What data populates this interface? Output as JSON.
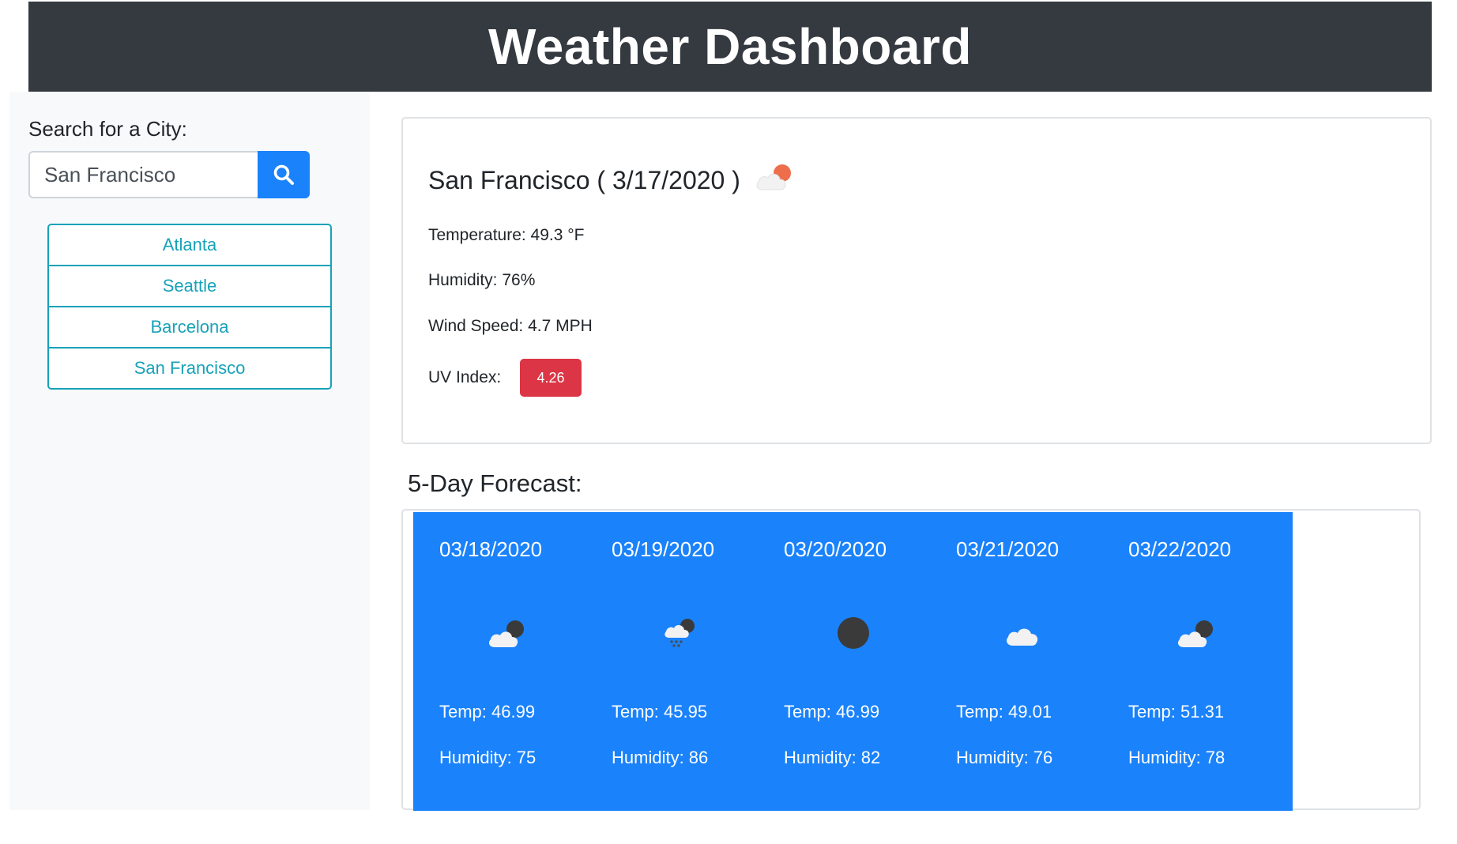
{
  "header": {
    "title": "Weather Dashboard"
  },
  "search": {
    "label": "Search for a City:",
    "value": "San Francisco",
    "button_icon": "search-icon"
  },
  "history": [
    {
      "label": "Atlanta"
    },
    {
      "label": "Seattle"
    },
    {
      "label": "Barcelona"
    },
    {
      "label": "San Francisco"
    }
  ],
  "current": {
    "title": "San Francisco ( 3/17/2020 )",
    "icon": "partly-cloudy-day-icon",
    "temperature": "Temperature: 49.3 °F",
    "humidity": "Humidity: 76%",
    "wind": "Wind Speed: 4.7 MPH",
    "uv_label": "UV Index:",
    "uv_value": "4.26",
    "uv_color": "#dc3545"
  },
  "forecast": {
    "title": "5-Day Forecast:",
    "card_color": "#1a82fb",
    "days": [
      {
        "date": "03/18/2020",
        "icon": "partly-cloudy-night-icon",
        "temp": "Temp: 46.99",
        "humidity": "Humidity: 75"
      },
      {
        "date": "03/19/2020",
        "icon": "rain-night-icon",
        "temp": "Temp: 45.95",
        "humidity": "Humidity: 86"
      },
      {
        "date": "03/20/2020",
        "icon": "clear-night-icon",
        "temp": "Temp: 46.99",
        "humidity": "Humidity: 82"
      },
      {
        "date": "03/21/2020",
        "icon": "cloud-icon",
        "temp": "Temp: 49.01",
        "humidity": "Humidity: 76"
      },
      {
        "date": "03/22/2020",
        "icon": "partly-cloudy-night-icon",
        "temp": "Temp: 51.31",
        "humidity": "Humidity: 78"
      }
    ]
  }
}
